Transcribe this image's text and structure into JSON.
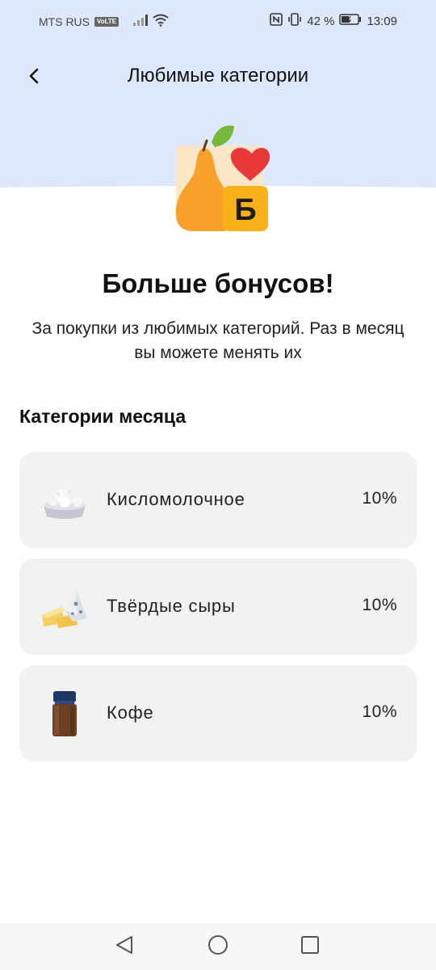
{
  "status_bar": {
    "carrier": "MTS RUS",
    "volte": "VoLTE",
    "battery_percent": "42 %",
    "time": "13:09"
  },
  "header": {
    "back_icon": "chevron-left-icon",
    "title": "Любимые категории"
  },
  "hero": {
    "badge_letter": "Б",
    "headline": "Больше бонусов!",
    "subtitle": "За покупки из любимых категорий. Раз в месяц вы можете менять их"
  },
  "section": {
    "title": "Категории месяца",
    "items": [
      {
        "label": "Кисломолочное",
        "percent": "10%",
        "icon": "cottage-cheese-bowl"
      },
      {
        "label": "Твёрдые сыры",
        "percent": "10%",
        "icon": "cheese-pieces"
      },
      {
        "label": "Кофе",
        "percent": "10%",
        "icon": "coffee-jar"
      }
    ]
  },
  "colors": {
    "top_background": "#dde9fb",
    "card_background": "#f2f2f2",
    "pear": "#f7a12b",
    "badge": "#f9b11a",
    "heart": "#e83a3a",
    "leaf": "#76b83b"
  },
  "nav_bar": {
    "back": "triangle-back-icon",
    "home": "circle-home-icon",
    "recents": "square-recents-icon"
  }
}
